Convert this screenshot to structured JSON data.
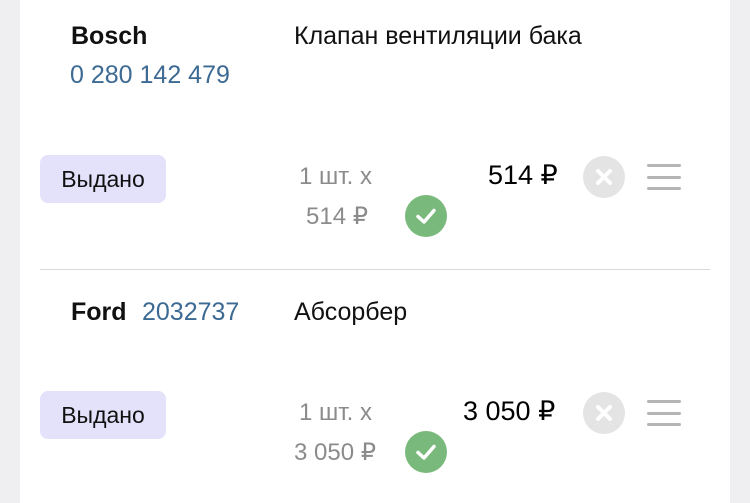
{
  "items": [
    {
      "brand": "Bosch",
      "code": "0 280 142 479",
      "name": "Клапан вентиляции бака",
      "status": "Выдано",
      "quantity": "1 шт. х",
      "unit_price": "514 ₽",
      "total": "514 ₽"
    },
    {
      "brand": "Ford",
      "code": "2032737",
      "name": "Абсорбер",
      "status": "Выдано",
      "quantity": "1 шт. х",
      "unit_price": "3 050 ₽",
      "total": "3 050 ₽"
    }
  ],
  "colors": {
    "status_badge_bg": "#e4e2fb",
    "code_link": "#3c6a93",
    "confirm_icon": "#79ba7c",
    "remove_icon": "#e4e4e4"
  },
  "icons": {
    "confirm": "check-icon",
    "remove": "close-icon",
    "menu": "hamburger-icon"
  }
}
